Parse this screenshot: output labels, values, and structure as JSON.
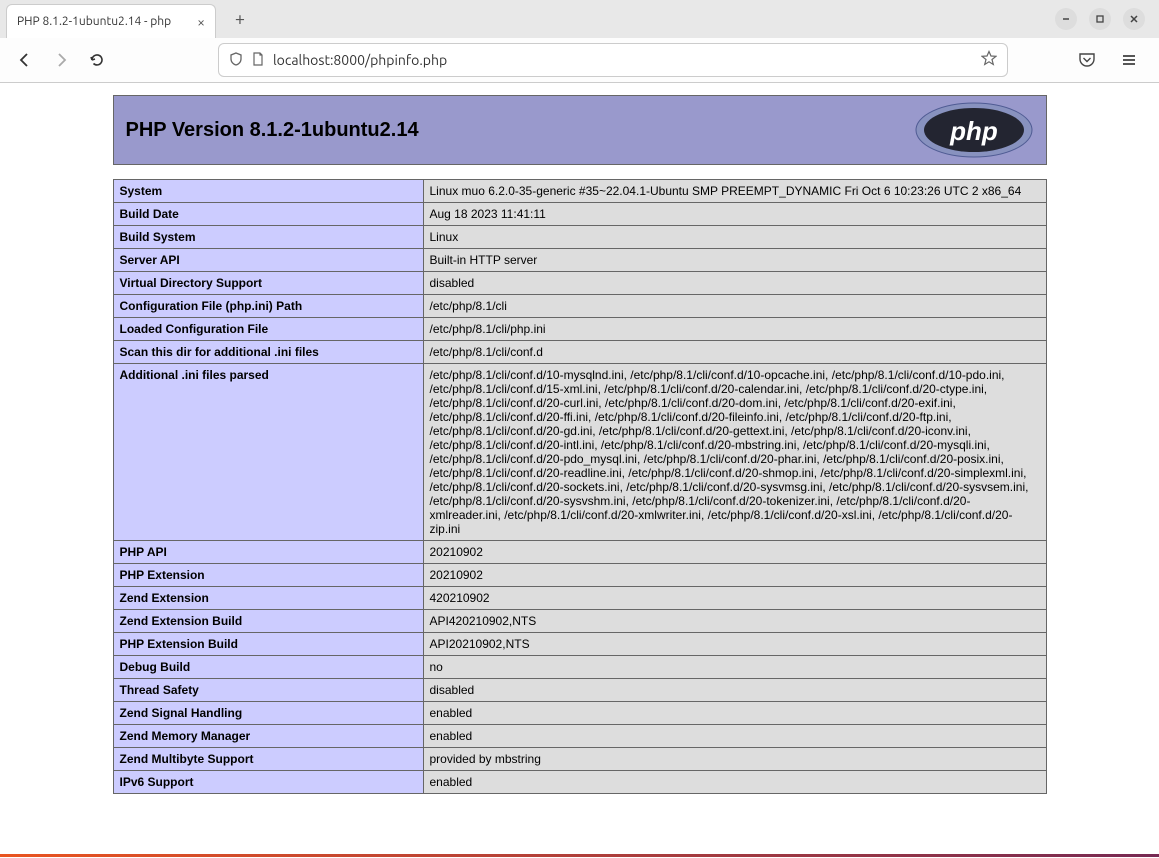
{
  "browser": {
    "tab_title": "PHP 8.1.2-1ubuntu2.14 - php",
    "url": "localhost:8000/phpinfo.php"
  },
  "header": {
    "title": "PHP Version 8.1.2-1ubuntu2.14",
    "logo_text": "php"
  },
  "rows": [
    {
      "label": "System",
      "value": "Linux muo 6.2.0-35-generic #35~22.04.1-Ubuntu SMP PREEMPT_DYNAMIC Fri Oct 6 10:23:26 UTC 2 x86_64"
    },
    {
      "label": "Build Date",
      "value": "Aug 18 2023 11:41:11"
    },
    {
      "label": "Build System",
      "value": "Linux"
    },
    {
      "label": "Server API",
      "value": "Built-in HTTP server"
    },
    {
      "label": "Virtual Directory Support",
      "value": "disabled"
    },
    {
      "label": "Configuration File (php.ini) Path",
      "value": "/etc/php/8.1/cli"
    },
    {
      "label": "Loaded Configuration File",
      "value": "/etc/php/8.1/cli/php.ini"
    },
    {
      "label": "Scan this dir for additional .ini files",
      "value": "/etc/php/8.1/cli/conf.d"
    },
    {
      "label": "Additional .ini files parsed",
      "value": "/etc/php/8.1/cli/conf.d/10-mysqlnd.ini, /etc/php/8.1/cli/conf.d/10-opcache.ini, /etc/php/8.1/cli/conf.d/10-pdo.ini, /etc/php/8.1/cli/conf.d/15-xml.ini, /etc/php/8.1/cli/conf.d/20-calendar.ini, /etc/php/8.1/cli/conf.d/20-ctype.ini, /etc/php/8.1/cli/conf.d/20-curl.ini, /etc/php/8.1/cli/conf.d/20-dom.ini, /etc/php/8.1/cli/conf.d/20-exif.ini, /etc/php/8.1/cli/conf.d/20-ffi.ini, /etc/php/8.1/cli/conf.d/20-fileinfo.ini, /etc/php/8.1/cli/conf.d/20-ftp.ini, /etc/php/8.1/cli/conf.d/20-gd.ini, /etc/php/8.1/cli/conf.d/20-gettext.ini, /etc/php/8.1/cli/conf.d/20-iconv.ini, /etc/php/8.1/cli/conf.d/20-intl.ini, /etc/php/8.1/cli/conf.d/20-mbstring.ini, /etc/php/8.1/cli/conf.d/20-mysqli.ini, /etc/php/8.1/cli/conf.d/20-pdo_mysql.ini, /etc/php/8.1/cli/conf.d/20-phar.ini, /etc/php/8.1/cli/conf.d/20-posix.ini, /etc/php/8.1/cli/conf.d/20-readline.ini, /etc/php/8.1/cli/conf.d/20-shmop.ini, /etc/php/8.1/cli/conf.d/20-simplexml.ini, /etc/php/8.1/cli/conf.d/20-sockets.ini, /etc/php/8.1/cli/conf.d/20-sysvmsg.ini, /etc/php/8.1/cli/conf.d/20-sysvsem.ini, /etc/php/8.1/cli/conf.d/20-sysvshm.ini, /etc/php/8.1/cli/conf.d/20-tokenizer.ini, /etc/php/8.1/cli/conf.d/20-xmlreader.ini, /etc/php/8.1/cli/conf.d/20-xmlwriter.ini, /etc/php/8.1/cli/conf.d/20-xsl.ini, /etc/php/8.1/cli/conf.d/20-zip.ini"
    },
    {
      "label": "PHP API",
      "value": "20210902"
    },
    {
      "label": "PHP Extension",
      "value": "20210902"
    },
    {
      "label": "Zend Extension",
      "value": "420210902"
    },
    {
      "label": "Zend Extension Build",
      "value": "API420210902,NTS"
    },
    {
      "label": "PHP Extension Build",
      "value": "API20210902,NTS"
    },
    {
      "label": "Debug Build",
      "value": "no"
    },
    {
      "label": "Thread Safety",
      "value": "disabled"
    },
    {
      "label": "Zend Signal Handling",
      "value": "enabled"
    },
    {
      "label": "Zend Memory Manager",
      "value": "enabled"
    },
    {
      "label": "Zend Multibyte Support",
      "value": "provided by mbstring"
    },
    {
      "label": "IPv6 Support",
      "value": "enabled"
    }
  ]
}
